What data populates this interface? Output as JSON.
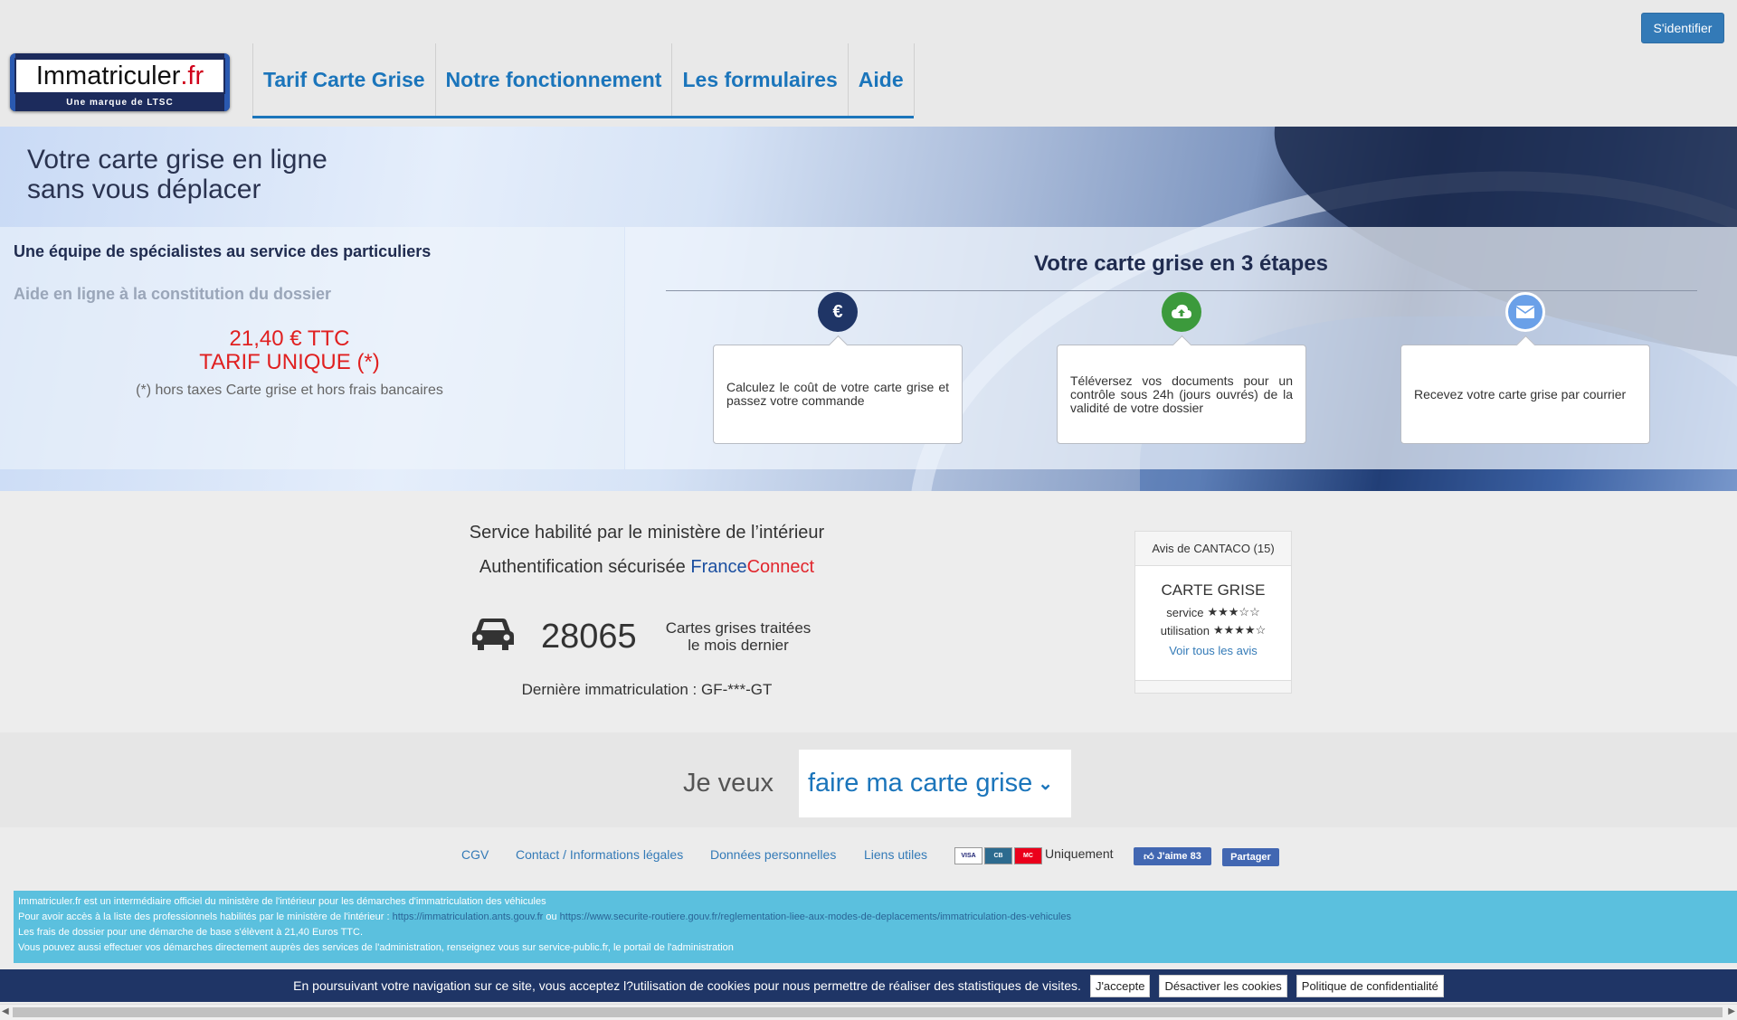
{
  "header": {
    "login_label": "S'identifier",
    "logo_text": "Immatriculer",
    "logo_tld": ".fr",
    "logo_tagline": "Une marque de LTSC",
    "nav": [
      "Tarif Carte Grise",
      "Notre fonctionnement",
      "Les formulaires",
      "Aide"
    ]
  },
  "hero": {
    "title_line1": "Votre carte grise en ligne",
    "title_line2": "sans vous déplacer",
    "team": "Une équipe de spécialistes au service des particuliers",
    "aid": "Aide en ligne à la constitution du dossier",
    "price_line1": "21,40 € TTC",
    "price_line2": "TARIF UNIQUE (*)",
    "price_note": "(*) hors taxes Carte grise et hors frais bancaires",
    "steps_title": "Votre carte grise en 3 étapes",
    "steps": [
      {
        "icon": "euro-icon",
        "color": "#1f3566",
        "text": "Calculez le coût de votre carte grise et passez votre commande"
      },
      {
        "icon": "cloud-upload-icon",
        "color": "#3c9a3c",
        "text": "Téléversez vos documents pour un contrôle sous 24h (jours ouvrés) de la validité de votre dossier"
      },
      {
        "icon": "envelope-icon",
        "color": "#6aa0e8",
        "text": "Recevez votre carte grise par courrier"
      }
    ]
  },
  "service": {
    "line1": "Service habilité par le ministère de l’intérieur",
    "line2_prefix": "Authentification sécurisée",
    "france": "France",
    "connect": "Connect",
    "count": "28065",
    "count_label_line1": "Cartes grises traitées",
    "count_label_line2": "le mois dernier",
    "last_reg": "Dernière immatriculation : GF-***-GT"
  },
  "review": {
    "header": "Avis de CANTACO (15)",
    "title": "CARTE GRISE",
    "service_label": "service",
    "service_stars": "★★★☆☆",
    "service_rating": 3,
    "usage_label": "utilisation",
    "usage_stars": "★★★★☆",
    "usage_rating": 4,
    "link": "Voir tous les avis"
  },
  "want": {
    "label": "Je veux",
    "selected": "faire ma carte grise"
  },
  "footer": {
    "links": [
      "CGV",
      "Contact / Informations légales",
      "Données personnelles",
      "Liens utiles"
    ],
    "cards": [
      "VISA",
      "CB",
      "MC"
    ],
    "only": "Uniquement",
    "fb_like": "J'aime 83",
    "fb_share": "Partager"
  },
  "info": {
    "line1": "Immatriculer.fr est un intermédiaire officiel du ministère de l'intérieur pour les démarches d'immatriculation des véhicules",
    "line2_prefix": "Pour avoir accès à la liste des professionnels habilités par le ministère de l'intérieur :",
    "link1": "https://immatriculation.ants.gouv.fr",
    "or": "ou",
    "link2": "https://www.securite-routiere.gouv.fr/reglementation-liee-aux-modes-de-deplacements/immatriculation-des-vehicules",
    "line3": "Les frais de dossier pour une démarche de base s'élèvent à 21,40 Euros TTC.",
    "line4": "Vous pouvez aussi effectuer vos démarches directement auprès des services de l'administration, renseignez vous sur service-public.fr, le portail de l'administration"
  },
  "cookie": {
    "text": "En poursuivant votre navigation sur ce site, vous acceptez l?utilisation de cookies pour nous permettre de réaliser des statistiques de visites.",
    "accept": "J'accepte",
    "disable": "Désactiver les cookies",
    "policy": "Politique de confidentialité"
  }
}
